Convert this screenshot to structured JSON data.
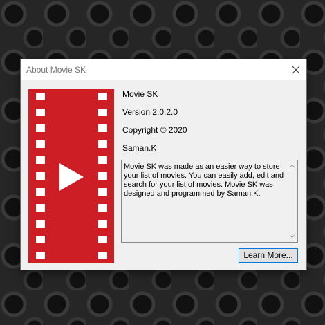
{
  "window": {
    "title": "About Movie SK"
  },
  "app": {
    "name": "Movie SK",
    "version": "Version 2.0.2.0",
    "copyright": "Copyright ©  2020",
    "author": "Saman.K"
  },
  "description": "Movie SK was made as an easier way to store\nyour list of movies. You can easily add, edit and\nsearch for your list of movies. Movie SK was\ndesigned and programmed by Saman.K.",
  "buttons": {
    "learn_more": "Learn More..."
  },
  "colors": {
    "logo_red": "#cc1e24",
    "button_border": "#0078d7",
    "dialog_bg": "#f0f0f0"
  }
}
